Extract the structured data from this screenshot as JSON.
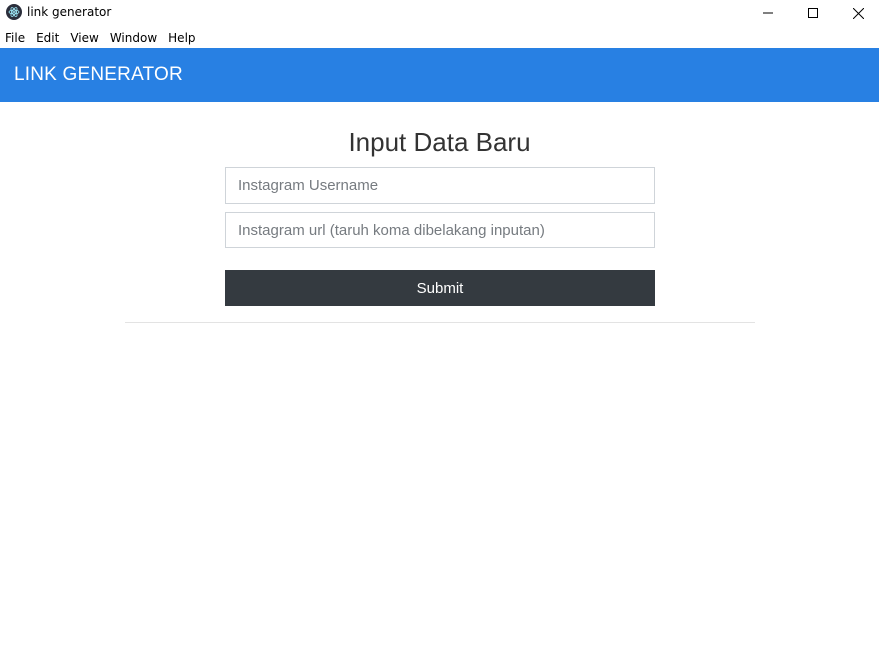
{
  "window": {
    "title": "link generator",
    "icon": "electron-atom-icon",
    "controls": [
      "minimize-icon",
      "maximize-icon",
      "close-icon"
    ]
  },
  "menu": {
    "items": [
      "File",
      "Edit",
      "View",
      "Window",
      "Help"
    ]
  },
  "header": {
    "title": "LINK GENERATOR",
    "color": "#2880e3"
  },
  "form": {
    "heading": "Input Data Baru",
    "username": {
      "value": "",
      "placeholder": "Instagram Username"
    },
    "url": {
      "value": "",
      "placeholder": "Instagram url (taruh koma dibelakang inputan)"
    },
    "submit_label": "Submit",
    "submit_color": "#343a40"
  }
}
